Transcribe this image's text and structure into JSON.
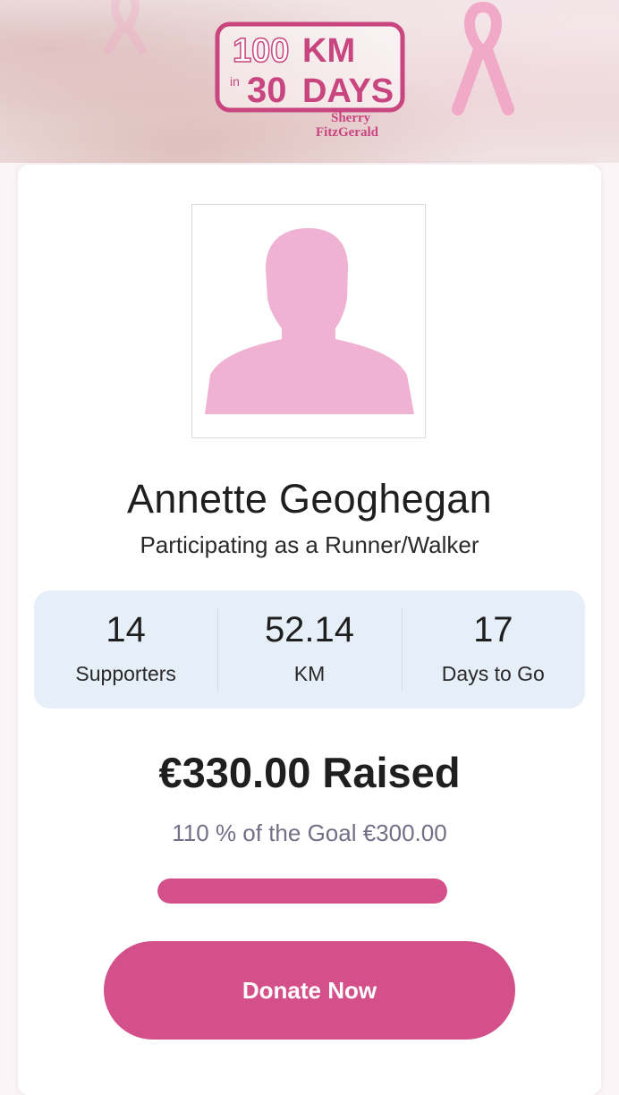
{
  "brand": {
    "logo_top_left": "100",
    "logo_in": "in",
    "logo_bottom_left": "30",
    "logo_top_right": "KM",
    "logo_bottom_right": "DAYS",
    "sponsor_line1": "Sherry",
    "sponsor_line2": "FitzGerald",
    "accent_color": "#d4508a"
  },
  "profile": {
    "name": "Annette Geoghegan",
    "role": "Participating as a Runner/Walker",
    "avatar_icon": "person-silhouette-icon"
  },
  "stats": [
    {
      "value": "14",
      "label": "Supporters"
    },
    {
      "value": "52.14",
      "label": "KM"
    },
    {
      "value": "17",
      "label": "Days to Go"
    }
  ],
  "fundraising": {
    "raised_text": "€330.00 Raised",
    "goal_text": "110 % of the Goal €300.00",
    "progress_percent": 100
  },
  "actions": {
    "donate_label": "Donate Now"
  }
}
